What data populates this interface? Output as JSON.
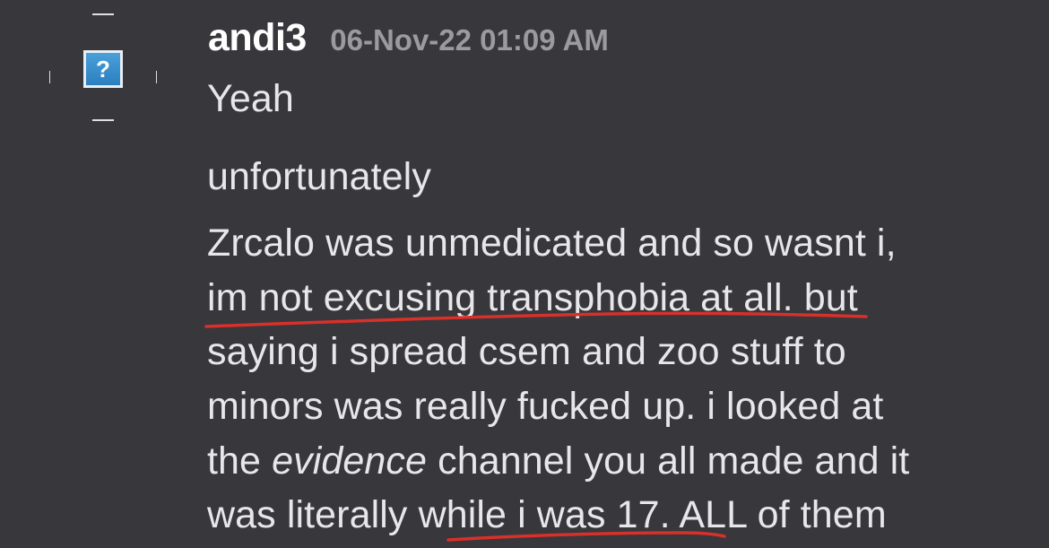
{
  "message": {
    "username": "andi3",
    "timestamp": "06-Nov-22 01:09 AM",
    "avatar_glyph": "?",
    "avatar_icon": "unknown-avatar-icon",
    "lines": {
      "l1": "Yeah",
      "l2": "unfortunately",
      "l3": "Zrcalo was unmedicated and so wasnt i,",
      "l4": "im not excusing transphobia at all. but",
      "l5": "saying i spread csem and zoo stuff to",
      "l6": "minors was really fucked up. i looked at",
      "l7_a": "the ",
      "l7_b": "evidence",
      "l7_c": " channel you all made and it",
      "l8": "was literally while i was 17. ALL of them"
    }
  },
  "colors": {
    "background": "#37373c",
    "username": "#ffffff",
    "timestamp": "#9a9a9f",
    "text": "#e7e7ea",
    "annotation": "#d8302a"
  }
}
